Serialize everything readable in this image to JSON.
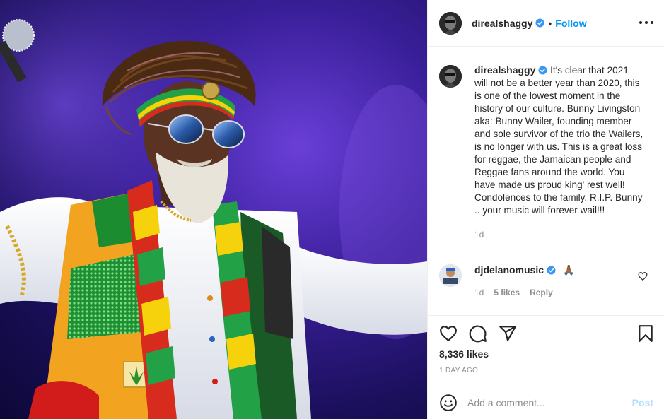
{
  "post": {
    "username": "direalshaggy",
    "follow_label": "Follow",
    "separator": "•",
    "more_icon": "more-options-icon",
    "caption_text": "It's clear that 2021 will not be a better year than 2020, this is one of the lowest moment in the history of our culture. Bunny Livingston aka: Bunny Wailer, founding member and sole survivor of the trio the Wailers, is no longer with us. This is a great loss for reggae, the Jamaican people and Reggae fans around the world. You have made us proud king' rest well! Condolences to the family. R.I.P. Bunny .. your music will forever wail!!!",
    "caption_time": "1d",
    "photo_description_icon": "post-photo"
  },
  "reply": {
    "username": "djdelanomusic",
    "text": "🙏🏾",
    "time": "1d",
    "likes": "5 likes",
    "reply_label": "Reply"
  },
  "actions": {
    "likes_count": "8,336 likes",
    "date": "1 DAY AGO"
  },
  "comment_box": {
    "placeholder": "Add a comment...",
    "post_label": "Post"
  },
  "colors": {
    "accent": "#0095f6",
    "post_disabled": "#b2dffc",
    "muted": "#8e8e8e",
    "text": "#262626",
    "verified": "#3897f0"
  }
}
